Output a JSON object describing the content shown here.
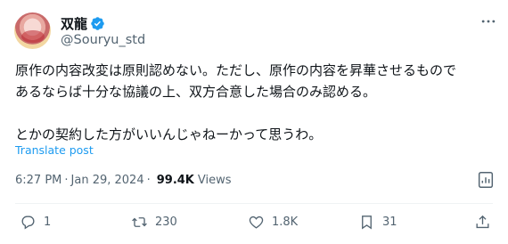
{
  "author": {
    "display_name": "双龍",
    "handle": "@Souryu_std",
    "verified": true
  },
  "tweet": {
    "text": "原作の内容改変は原則認めない。ただし、原作の内容を昇華させるもので\nあるならば十分な協議の上、双方合意した場合のみ認める。\n\nとかの契約した方がいいんじゃねーかって思うわ。",
    "translate_label": "Translate post"
  },
  "meta": {
    "time": "6:27 PM",
    "date": "Jan 29, 2024",
    "separator": "·",
    "views_count": "99.4K",
    "views_label": "Views"
  },
  "actions": {
    "reply_count": "1",
    "retweet_count": "230",
    "like_count": "1.8K",
    "bookmark_count": "31"
  },
  "colors": {
    "accent": "#1d9bf0",
    "text_primary": "#0f1419",
    "text_secondary": "#536471",
    "divider": "#eff3f4"
  },
  "icons": [
    "verified-badge-icon",
    "more-options-icon",
    "analytics-icon",
    "reply-icon",
    "retweet-icon",
    "like-icon",
    "bookmark-icon",
    "share-icon"
  ]
}
